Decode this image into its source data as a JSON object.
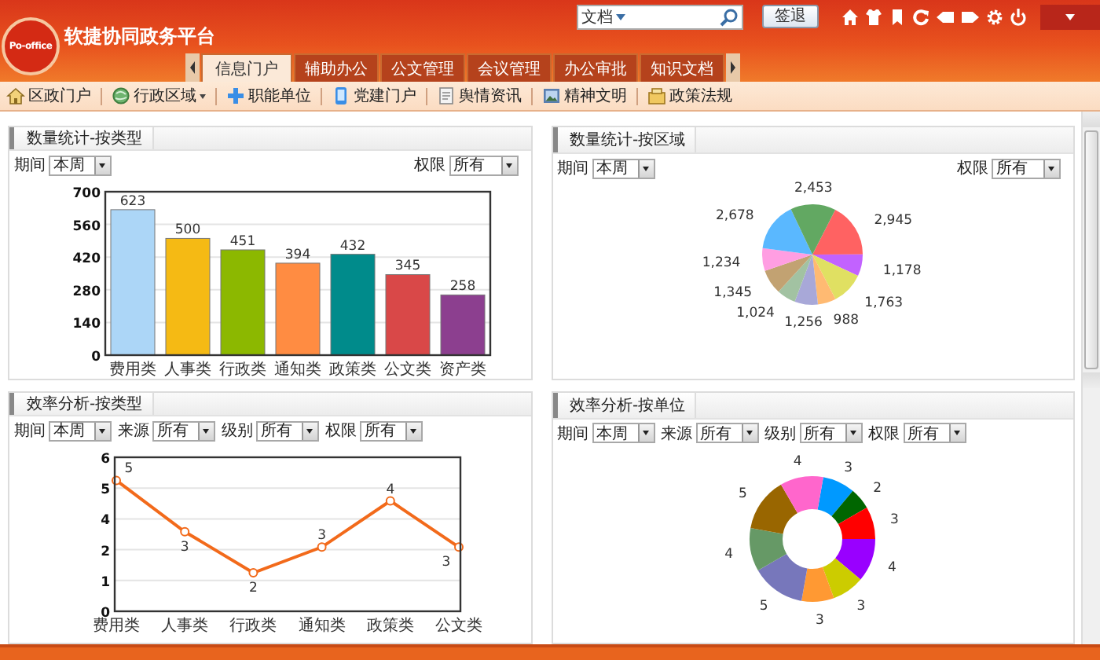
{
  "header": {
    "logo": "Po-office",
    "title": "软捷协同政务平台",
    "search": {
      "scope": "文档"
    },
    "logout": "签退"
  },
  "tabs": [
    {
      "label": "信息门户",
      "selected": true
    },
    {
      "label": "辅助办公",
      "selected": false
    },
    {
      "label": "公文管理",
      "selected": false
    },
    {
      "label": "会议管理",
      "selected": false
    },
    {
      "label": "办公审批",
      "selected": false
    },
    {
      "label": "知识文档",
      "selected": false
    }
  ],
  "toolbar": [
    {
      "label": "区政门户",
      "has_menu": false
    },
    {
      "label": "行政区域",
      "has_menu": true
    },
    {
      "label": "职能单位",
      "has_menu": false
    },
    {
      "label": "党建门户",
      "has_menu": false
    },
    {
      "label": "舆情资讯",
      "has_menu": false
    },
    {
      "label": "精神文明",
      "has_menu": false
    },
    {
      "label": "政策法规",
      "has_menu": false
    }
  ],
  "panels": [
    {
      "title": "数量统计-按类型",
      "filters": [
        {
          "label": "期间",
          "value": "本周"
        },
        {
          "label": "权限",
          "value": "所有"
        }
      ],
      "chart_data": {
        "type": "bar",
        "categories": [
          "费用类",
          "人事类",
          "行政类",
          "通知类",
          "政策类",
          "公文类",
          "资产类"
        ],
        "values": [
          623,
          500,
          451,
          394,
          432,
          345,
          258
        ],
        "colors": [
          "#acd6f7",
          "#f5ba14",
          "#8cb800",
          "#ff8c42",
          "#008b8b",
          "#d94848",
          "#8c3f8f"
        ],
        "ylim": [
          0,
          700
        ],
        "yticks": [
          0,
          140,
          280,
          420,
          560,
          700
        ],
        "grid": true,
        "data_labels": true
      }
    },
    {
      "title": "数量统计-按区域",
      "filters": [
        {
          "label": "期间",
          "value": "本周"
        },
        {
          "label": "权限",
          "value": "所有"
        }
      ],
      "chart_data": {
        "type": "pie",
        "values": [
          2945,
          1178,
          1763,
          988,
          1256,
          1024,
          1345,
          1234,
          2678,
          2453
        ],
        "colors": [
          "#ff6262",
          "#c262ff",
          "#e0e062",
          "#ffba72",
          "#a8a8d8",
          "#a2c2a2",
          "#c2a272",
          "#ff9ee2",
          "#5ab8ff",
          "#62a862"
        ],
        "value_labels": [
          "2,945",
          "1,178",
          "1,763",
          "988",
          "1,256",
          "1,024",
          "1,345",
          "1,234",
          "2,678",
          "2,453"
        ]
      }
    },
    {
      "title": "效率分析-按类型",
      "filters": [
        {
          "label": "期间",
          "value": "本周"
        },
        {
          "label": "来源",
          "value": "所有"
        },
        {
          "label": "级别",
          "value": "所有"
        },
        {
          "label": "权限",
          "value": "所有"
        }
      ],
      "chart_data": {
        "type": "line",
        "categories": [
          "费用类",
          "人事类",
          "行政类",
          "通知类",
          "政策类",
          "公文类"
        ],
        "series": [
          {
            "color": "#f26a1b",
            "marker": true,
            "values": [
              5.1,
              3.1,
              1.5,
              2.5,
              4.3,
              2.5
            ]
          }
        ],
        "ylim": [
          0,
          6
        ],
        "grid": true,
        "yticks": [
          0,
          {
            "value": 1.2,
            "label": "1"
          },
          {
            "value": 2.4,
            "label": "2"
          },
          {
            "value": 3.6,
            "label": "4"
          },
          {
            "value": 4.8,
            "label": "5"
          },
          6
        ],
        "value_labels": [
          "5",
          "3",
          "2",
          "3",
          "4",
          "3"
        ]
      }
    },
    {
      "title": "效率分析-按单位",
      "filters": [
        {
          "label": "期间",
          "value": "本周"
        },
        {
          "label": "来源",
          "value": "所有"
        },
        {
          "label": "级别",
          "value": "所有"
        },
        {
          "label": "权限",
          "value": "所有"
        }
      ],
      "chart_data": {
        "type": "donut",
        "values": [
          3,
          2,
          3,
          4,
          3,
          3,
          5,
          4,
          5,
          4
        ],
        "colors": [
          "#0099ff",
          "#006600",
          "#ff0000",
          "#9900ff",
          "#cccc00",
          "#ff9933",
          "#7777bb",
          "#669966",
          "#996600",
          "#ff66cc"
        ],
        "data_labels": true
      }
    }
  ]
}
